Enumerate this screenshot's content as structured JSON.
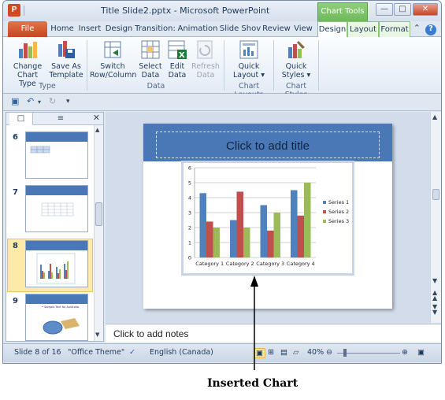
{
  "window": {
    "title": "Title Slide2.pptx - Microsoft PowerPoint",
    "app_icon_letter": "P",
    "context_tab_group": "Chart Tools",
    "controls": {
      "minimize": "—",
      "maximize": "□",
      "close": "✕"
    }
  },
  "tabs": [
    "File",
    "Home",
    "Insert",
    "Design",
    "Transition:",
    "Animation",
    "Slide Shov",
    "Review",
    "View",
    "Design",
    "Layout",
    "Format"
  ],
  "ribbon": {
    "groups": [
      {
        "label": "Type",
        "buttons": [
          "Change Chart Type",
          "Save As Template"
        ]
      },
      {
        "label": "Data",
        "buttons": [
          "Switch Row/Column",
          "Select Data",
          "Edit Data",
          "Refresh Data"
        ]
      },
      {
        "label": "Chart Layouts",
        "buttons": [
          "Quick Layout ▾"
        ]
      },
      {
        "label": "Chart Styles",
        "buttons": [
          "Quick Styles ▾"
        ]
      }
    ],
    "btn_change_l1": "Change",
    "btn_change_l2": "Chart Type",
    "btn_saveas_l1": "Save As",
    "btn_saveas_l2": "Template",
    "btn_switch_l1": "Switch",
    "btn_switch_l2": "Row/Column",
    "btn_select_l1": "Select",
    "btn_select_l2": "Data",
    "btn_edit_l1": "Edit",
    "btn_edit_l2": "Data",
    "btn_refresh_l1": "Refresh",
    "btn_refresh_l2": "Data",
    "btn_qlayout_l1": "Quick",
    "btn_qlayout_l2": "Layout ▾",
    "btn_qstyles_l1": "Quick",
    "btn_qstyles_l2": "Styles ▾",
    "group_type": "Type",
    "group_data": "Data",
    "group_layouts": "Chart Layouts",
    "group_styles": "Chart Styles"
  },
  "slides_pane": {
    "thumbnails": [
      {
        "number": "6"
      },
      {
        "number": "7"
      },
      {
        "number": "8",
        "selected": true
      },
      {
        "number": "9",
        "caption": "• Sample Text for Australia"
      }
    ]
  },
  "slide": {
    "title_placeholder": "Click to add title"
  },
  "notes_placeholder": "Click to add notes",
  "status": {
    "slide_of": "Slide 8 of 16",
    "theme": "\"Office Theme\"",
    "language": "English (Canada)",
    "zoom": "40%"
  },
  "caption": "Inserted Chart",
  "colors": {
    "series1": "#4f81bd",
    "series2": "#c0504d",
    "series3": "#9bbb59"
  },
  "chart_data": {
    "type": "bar",
    "categories": [
      "Category 1",
      "Category 2",
      "Category 3",
      "Category 4"
    ],
    "series": [
      {
        "name": "Series 1",
        "values": [
          4.3,
          2.5,
          3.5,
          4.5
        ]
      },
      {
        "name": "Series 2",
        "values": [
          2.4,
          4.4,
          1.8,
          2.8
        ]
      },
      {
        "name": "Series 3",
        "values": [
          2,
          2,
          3,
          5
        ]
      }
    ],
    "ylim": [
      0,
      6
    ],
    "yticks": [
      "0",
      "1",
      "2",
      "3",
      "4",
      "5",
      "6"
    ],
    "grid": true,
    "legend": "right"
  }
}
